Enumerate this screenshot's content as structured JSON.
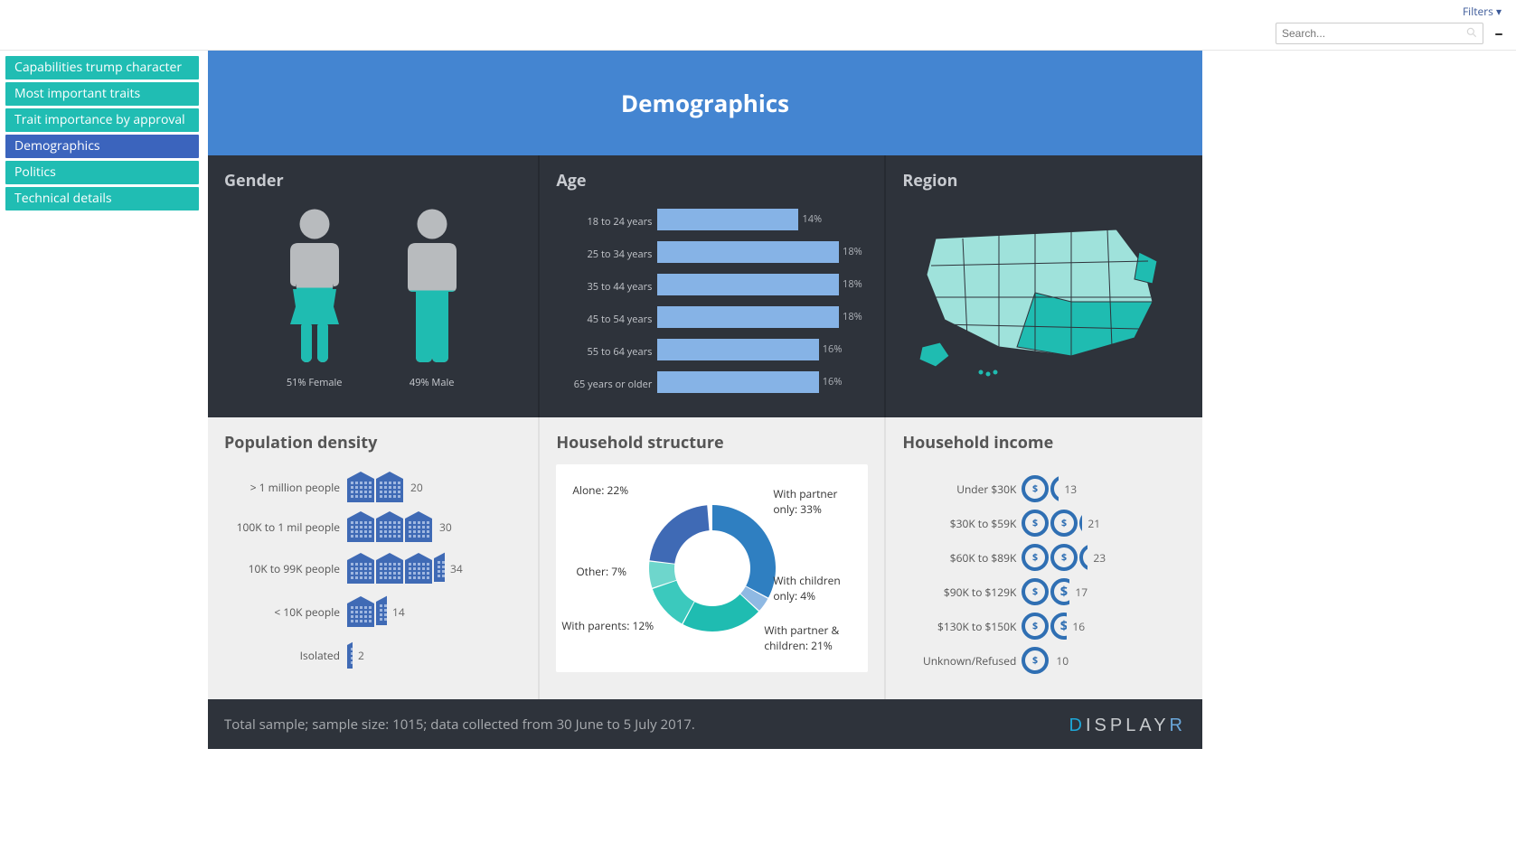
{
  "topbar": {
    "filters_label": "Filters ▾",
    "search_placeholder": "Search...",
    "minimize_symbol": "–"
  },
  "sidebar": {
    "items": [
      {
        "label": "Capabilities trump character",
        "active": false
      },
      {
        "label": "Most important traits",
        "active": false
      },
      {
        "label": "Trait importance by approval",
        "active": false
      },
      {
        "label": "Demographics",
        "active": true
      },
      {
        "label": "Politics",
        "active": false
      },
      {
        "label": "Technical details",
        "active": false
      }
    ]
  },
  "header": {
    "title": "Demographics"
  },
  "panels": {
    "gender": {
      "title": "Gender",
      "female_label": "51% Female",
      "male_label": "49% Male"
    },
    "age": {
      "title": "Age"
    },
    "region": {
      "title": "Region"
    },
    "density": {
      "title": "Population density"
    },
    "household": {
      "title": "Household structure"
    },
    "income": {
      "title": "Household income"
    }
  },
  "footer": {
    "note": "Total sample; sample size: 1015; data collected from 30 June to 5 July 2017.",
    "brand": "DISPLAYR"
  },
  "chart_data": [
    {
      "id": "gender",
      "type": "pictogram",
      "title": "Gender",
      "series": [
        {
          "name": "Female",
          "value": 51,
          "unit": "%"
        },
        {
          "name": "Male",
          "value": 49,
          "unit": "%"
        }
      ]
    },
    {
      "id": "age",
      "type": "bar",
      "orientation": "horizontal",
      "title": "Age",
      "categories": [
        "18 to 24 years",
        "25 to 34 years",
        "35 to 44 years",
        "45 to 54 years",
        "55 to 64 years",
        "65 years or older"
      ],
      "values": [
        14,
        18,
        18,
        18,
        16,
        16
      ],
      "unit": "%",
      "xlim": [
        0,
        20
      ]
    },
    {
      "id": "region",
      "type": "map",
      "title": "Region",
      "geography": "USA",
      "legend": "choropleth by region (darker = higher share)"
    },
    {
      "id": "population_density",
      "type": "pictogram-bar",
      "title": "Population density",
      "categories": [
        "> 1 million people",
        "100K to 1 mil people",
        "10K to 99K people",
        "< 10K people",
        "Isolated"
      ],
      "values": [
        20,
        30,
        34,
        14,
        2
      ],
      "unit": "%",
      "icons_per_row": 10
    },
    {
      "id": "household_structure",
      "type": "pie",
      "title": "Household structure",
      "series": [
        {
          "name": "With partner only",
          "value": 33,
          "unit": "%"
        },
        {
          "name": "Alone",
          "value": 22,
          "unit": "%"
        },
        {
          "name": "With partner & children",
          "value": 21,
          "unit": "%"
        },
        {
          "name": "With parents",
          "value": 12,
          "unit": "%"
        },
        {
          "name": "Other",
          "value": 7,
          "unit": "%"
        },
        {
          "name": "With children only",
          "value": 4,
          "unit": "%"
        }
      ],
      "donut": true
    },
    {
      "id": "household_income",
      "type": "pictogram-bar",
      "title": "Household income",
      "categories": [
        "Under $30K",
        "$30K to $59K",
        "$60K to $89K",
        "$90K to $129K",
        "$130K to $150K",
        "Unknown/Refused"
      ],
      "values": [
        13,
        21,
        23,
        17,
        16,
        10
      ],
      "unit": "%",
      "icons_per_row": 10
    }
  ]
}
